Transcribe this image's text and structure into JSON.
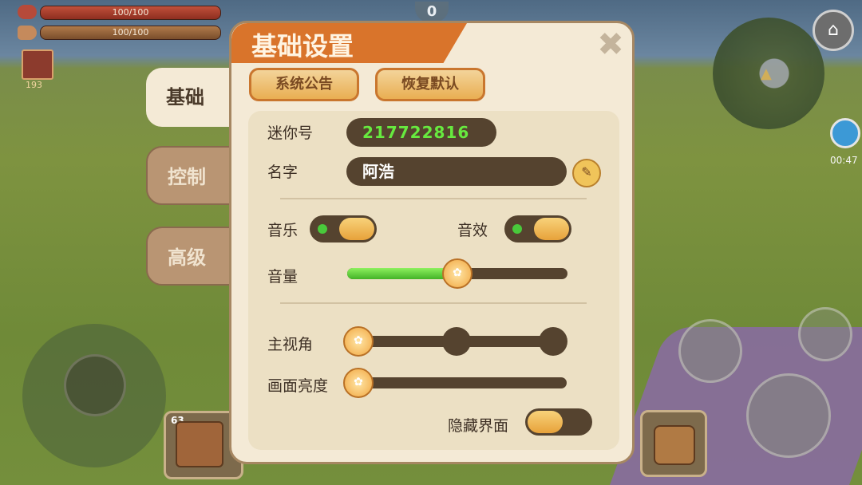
{
  "hud": {
    "health_text": "100/100",
    "hunger_text": "100/100",
    "buff_count": "193",
    "top_counter": "0",
    "clock": "00:47",
    "hotbar_count": "63"
  },
  "tabs": [
    {
      "label": "基础",
      "active": true
    },
    {
      "label": "控制",
      "active": false
    },
    {
      "label": "高级",
      "active": false
    }
  ],
  "dialog": {
    "title": "基础设置",
    "close_glyph": "✖",
    "buttons": {
      "announcement": "系统公告",
      "restore_default": "恢复默认"
    },
    "mini_id": {
      "label": "迷你号",
      "value": "217722816"
    },
    "name": {
      "label": "名字",
      "value": "阿浩"
    },
    "music": {
      "label": "音乐",
      "on": true
    },
    "sound_fx": {
      "label": "音效",
      "on": true
    },
    "volume": {
      "label": "音量",
      "level": 0.5
    },
    "view": {
      "label": "主视角",
      "stops": 3,
      "selected": 0
    },
    "brightness": {
      "label": "画面亮度",
      "level": 0.0
    },
    "hide_ui": {
      "label": "隐藏界面",
      "on": false
    }
  },
  "colors": {
    "accent_orange": "#d9742b",
    "panel": "#f4ead6",
    "dark_field": "#55432f",
    "id_green": "#67ea3f"
  },
  "icons": {
    "close": "close-icon",
    "edit": "pencil-icon",
    "paw": "paw-icon",
    "map": "map-toggle-icon",
    "clock": "clock-icon"
  }
}
